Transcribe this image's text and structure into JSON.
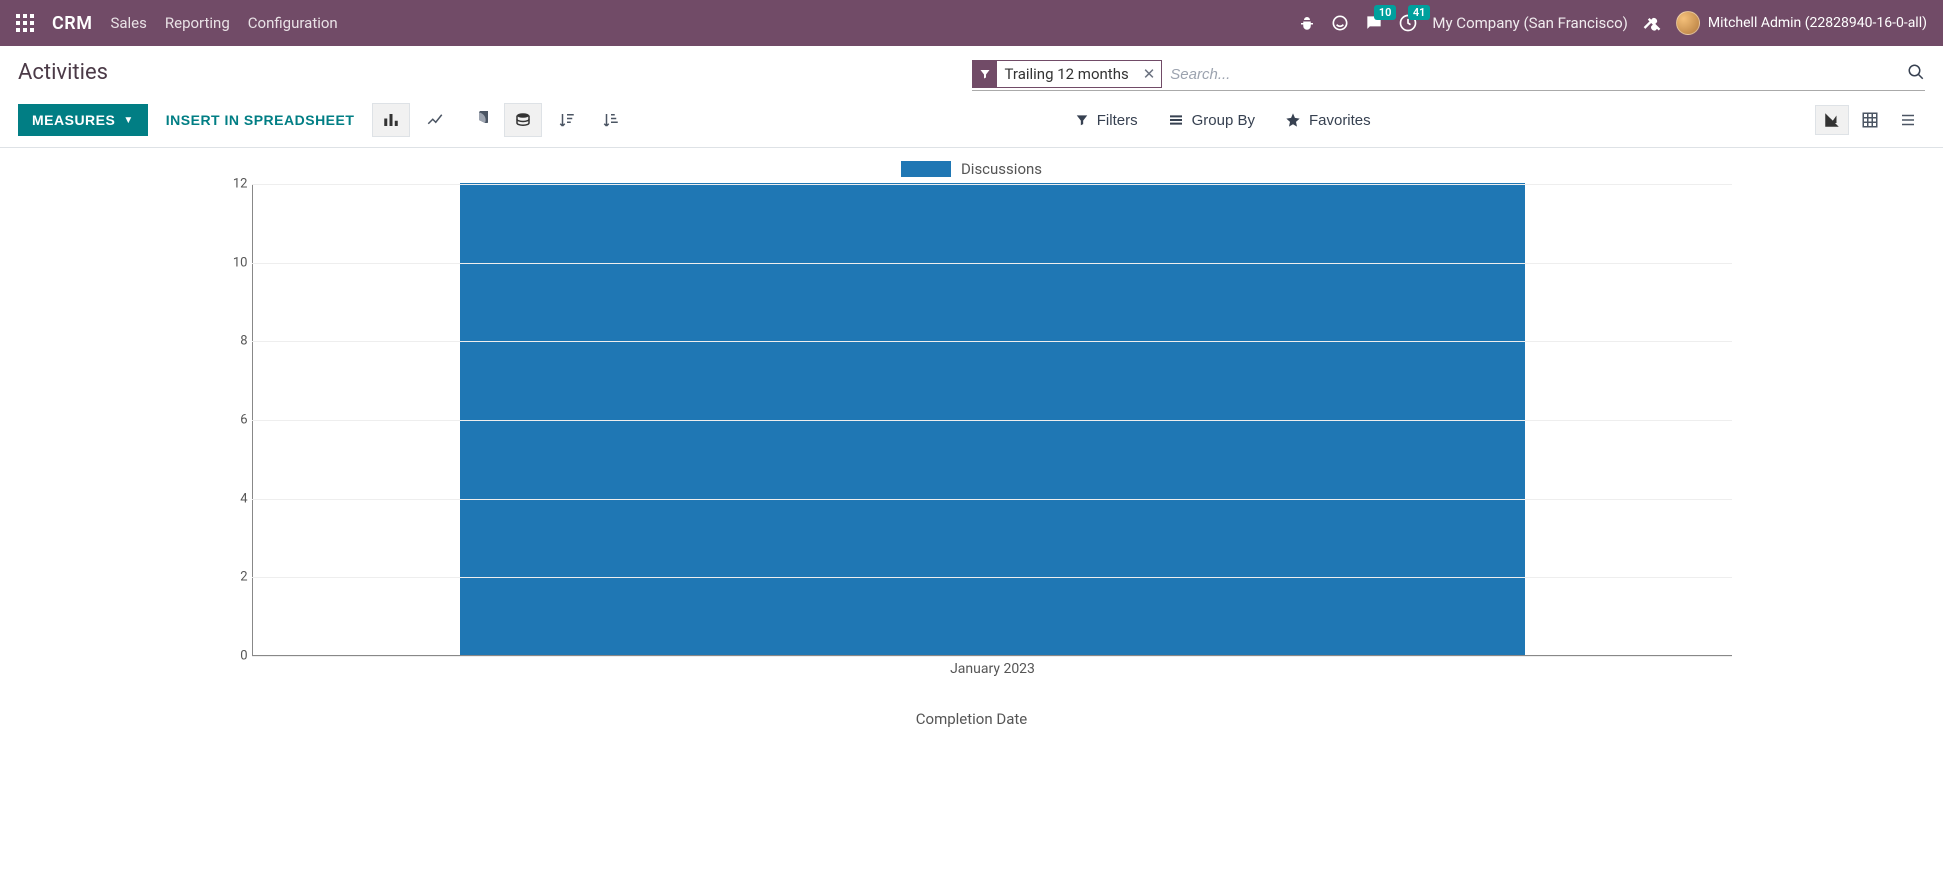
{
  "navbar": {
    "brand": "CRM",
    "menu": [
      "Sales",
      "Reporting",
      "Configuration"
    ],
    "company": "My Company (San Francisco)",
    "user": "Mitchell Admin (22828940-16-0-all)",
    "badges": {
      "messages": "10",
      "activities": "41"
    }
  },
  "header": {
    "title": "Activities",
    "search_placeholder": "Search...",
    "facet": "Trailing 12 months"
  },
  "controls": {
    "measures": "MEASURES",
    "insert_spreadsheet": "INSERT IN SPREADSHEET",
    "filters": "Filters",
    "group_by": "Group By",
    "favorites": "Favorites"
  },
  "legend": {
    "label": "Discussions"
  },
  "axis": {
    "xlabel": "Completion Date"
  },
  "chart_data": {
    "type": "bar",
    "title": "",
    "series_name": "Discussions",
    "categories": [
      "January 2023"
    ],
    "values": [
      12
    ],
    "xlabel": "Completion Date",
    "ylabel": "",
    "ylim": [
      0,
      12
    ],
    "yticks": [
      0,
      2,
      4,
      6,
      8,
      10,
      12
    ],
    "color": "#1f77b4"
  }
}
